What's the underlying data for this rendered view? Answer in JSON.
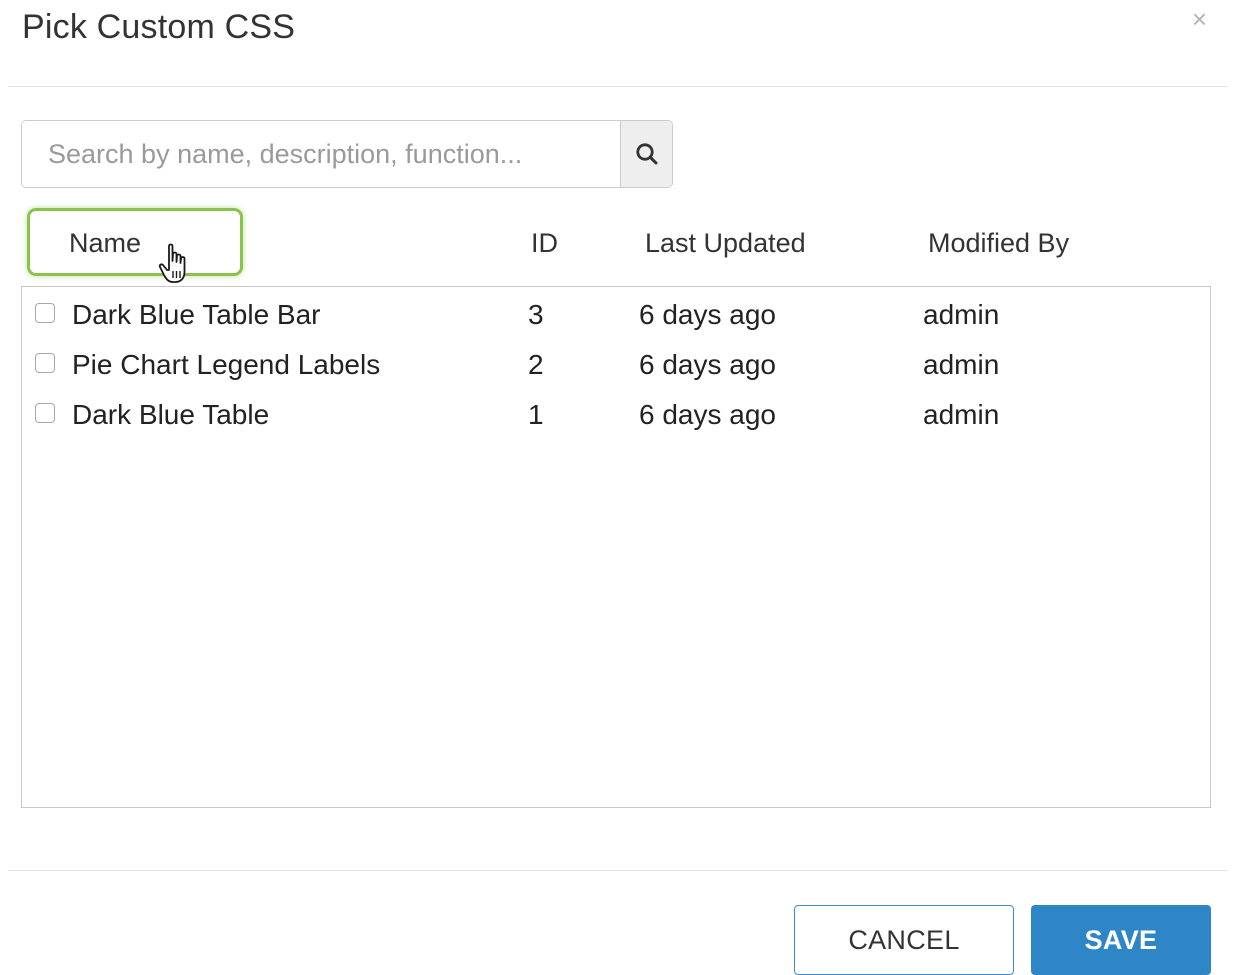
{
  "dialog": {
    "title": "Pick Custom CSS",
    "close_glyph": "×"
  },
  "search": {
    "placeholder": "Search by name, description, function...",
    "value": "",
    "button_icon": "search-icon"
  },
  "table": {
    "columns": {
      "name": "Name",
      "id": "ID",
      "last_updated": "Last Updated",
      "modified_by": "Modified By"
    },
    "rows": [
      {
        "name": "Dark Blue Table Bar",
        "id": "3",
        "last_updated": "6 days ago",
        "modified_by": "admin",
        "checked": false
      },
      {
        "name": "Pie Chart Legend Labels",
        "id": "2",
        "last_updated": "6 days ago",
        "modified_by": "admin",
        "checked": false
      },
      {
        "name": "Dark Blue Table",
        "id": "1",
        "last_updated": "6 days ago",
        "modified_by": "admin",
        "checked": false
      }
    ]
  },
  "footer": {
    "cancel_label": "CANCEL",
    "save_label": "SAVE"
  },
  "colors": {
    "primary": "#2f86c6",
    "highlight": "#8bc34a"
  }
}
